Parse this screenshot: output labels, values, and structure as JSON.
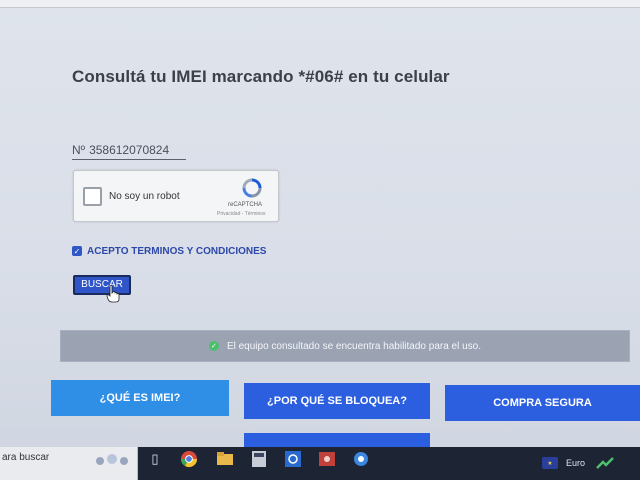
{
  "page": {
    "heading": "Consultá tu IMEI marcando *#06# en tu celular",
    "imei": {
      "prefix": "Nº",
      "value": "358612070824"
    },
    "captcha": {
      "label": "No soy un robot",
      "brand": "reCAPTCHA",
      "terms": "Privacidad - Términos",
      "checked": false
    },
    "terms": {
      "label": "ACEPTO TERMINOS Y CONDICIONES",
      "checked": true
    },
    "search_button": "BUSCAR",
    "status": {
      "text": "El equipo consultado se encuentra habilitado para el uso.",
      "icon": "check-circle-icon",
      "color": "#4dbf6c"
    },
    "nav_buttons": [
      {
        "label": "¿QUÉ ES IMEI?"
      },
      {
        "label": "¿POR QUÉ SE BLOQUEA?"
      },
      {
        "label": "COMPRA SEGURA"
      }
    ]
  },
  "taskbar": {
    "search_placeholder": "ara buscar",
    "icons": [
      "cortana-icon",
      "task-view-icon",
      "chrome-icon",
      "file-explorer-icon",
      "calculator-icon",
      "app-icon",
      "media-icon",
      "network-icon"
    ],
    "language": "Euro"
  },
  "colors": {
    "primary_blue": "#2c5fe0",
    "light_blue": "#2f8ee6",
    "status_bar": "#9ba3b3",
    "taskbar": "#1d2433"
  }
}
